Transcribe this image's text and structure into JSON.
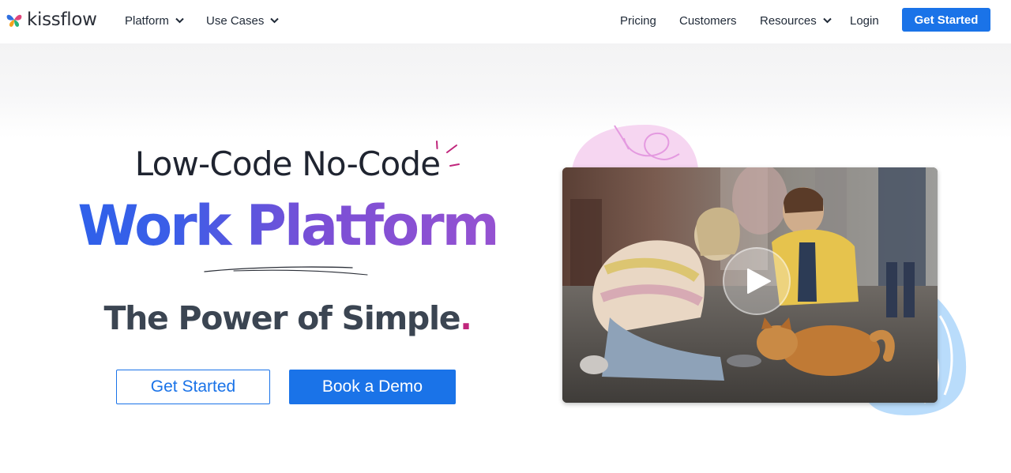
{
  "nav": {
    "brand": "kissflow",
    "left_items": [
      {
        "label": "Platform",
        "has_dropdown": true
      },
      {
        "label": "Use Cases",
        "has_dropdown": true
      }
    ],
    "right_items": [
      {
        "label": "Pricing",
        "has_dropdown": false
      },
      {
        "label": "Customers",
        "has_dropdown": false
      },
      {
        "label": "Resources",
        "has_dropdown": true
      },
      {
        "label": "Login",
        "has_dropdown": false
      }
    ],
    "cta_label": "Get Started"
  },
  "hero": {
    "kicker": "Low-Code No-Code",
    "headline": "Work Platform",
    "tagline": "The Power of Simple",
    "tagline_dot": ".",
    "primary_button": "Book a Demo",
    "secondary_button": "Get Started"
  },
  "video": {
    "play_icon": "play-icon"
  },
  "colors": {
    "brand_blue": "#1a73e8",
    "headline_gradient_start": "#2563eb",
    "headline_gradient_end": "#a153cf",
    "accent_magenta": "#c0267c",
    "tagline_text": "#3b4552",
    "blob_pink": "#f5d5f1",
    "blob_blue": "#b9dcfb"
  }
}
